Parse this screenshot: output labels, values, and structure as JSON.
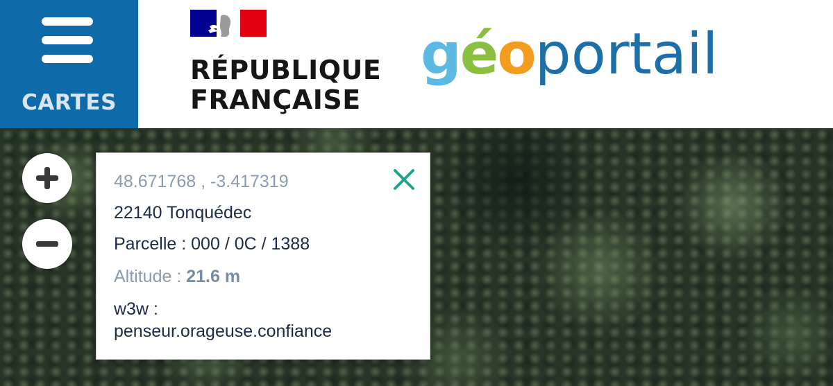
{
  "header": {
    "menu_label": "CARTES",
    "republique_text": "RÉPUBLIQUE\nFRANÇAISE",
    "logo": {
      "g": "g",
      "e": "é",
      "o": "o",
      "rest": "portail"
    }
  },
  "colors": {
    "menu_bg": "#0e6aa8",
    "logo_blue_light": "#5bb9e3",
    "logo_green": "#8bbf3f",
    "logo_orange": "#f29d1f",
    "logo_blue_dark": "#1e6fa8",
    "close_icon": "#1fa58c"
  },
  "map": {
    "zoom_in_icon": "plus-icon",
    "zoom_out_icon": "minus-icon"
  },
  "popup": {
    "coordinates": "48.671768 , -3.417319",
    "address": "22140 Tonquédec",
    "parcel": "Parcelle : 000 / 0C / 1388",
    "altitude_label": "Altitude : ",
    "altitude_value": "21.6 m",
    "w3w_label": "w3w :",
    "w3w_value": "penseur.orageuse.confiance",
    "close_icon": "close-icon"
  }
}
